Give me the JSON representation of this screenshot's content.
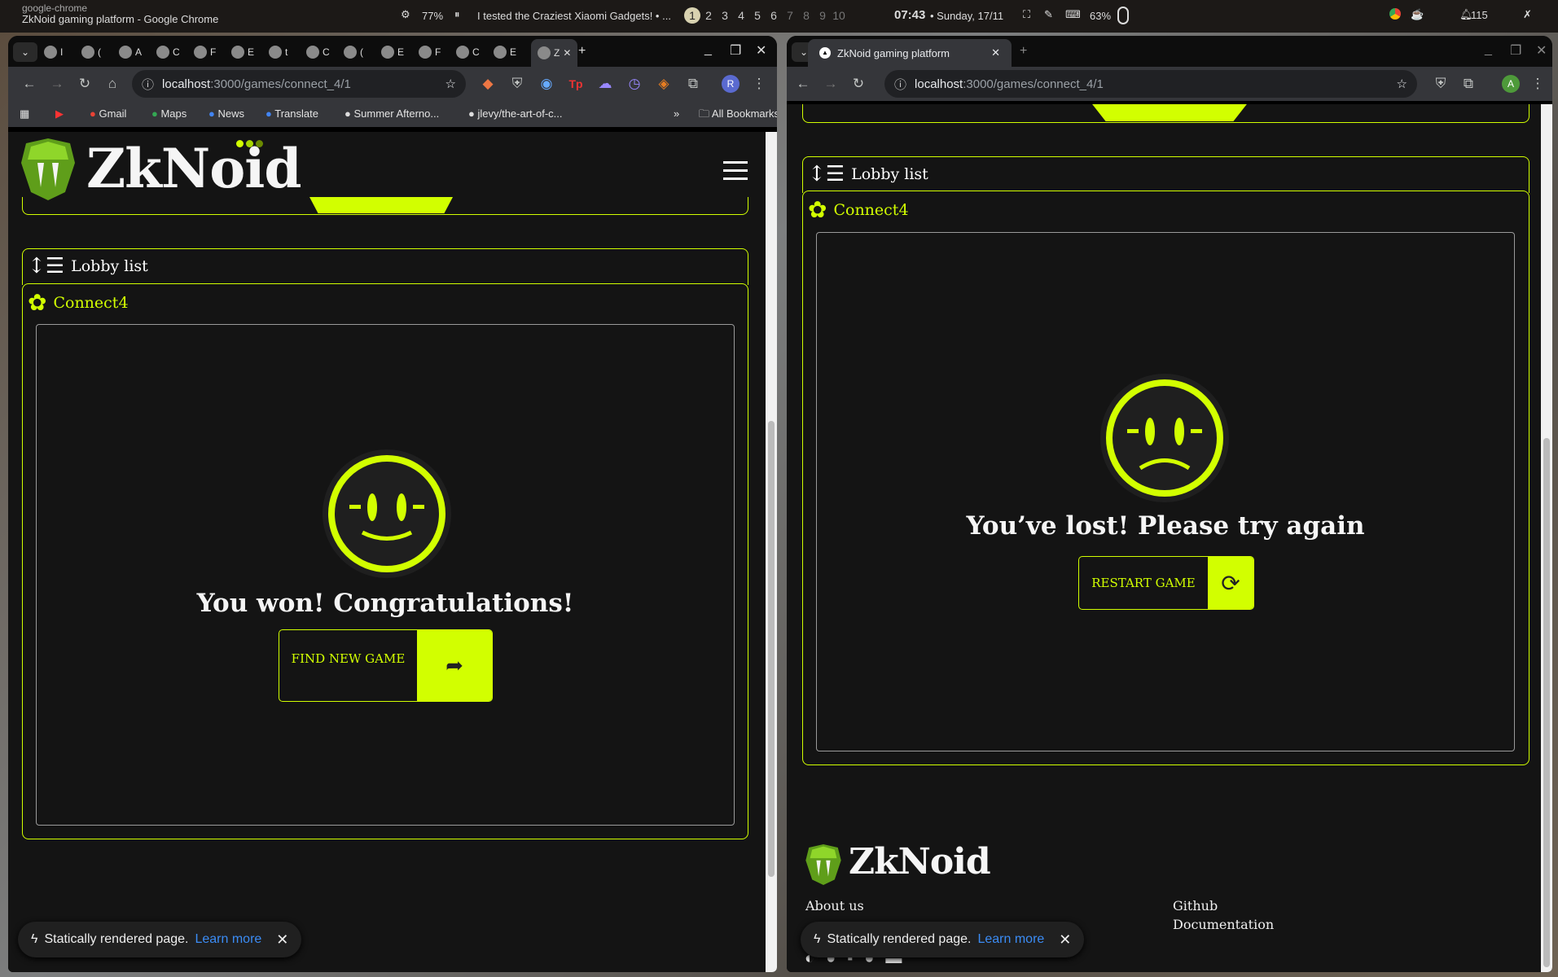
{
  "system_bar": {
    "app_id": "google-chrome",
    "window_title": "ZkNoid gaming platform - Google Chrome",
    "cpu": "77%",
    "media": "I tested the Craziest Xiaomi Gadgets! • ...",
    "workspaces": [
      "1",
      "2",
      "3",
      "4",
      "5",
      "6",
      "7",
      "8",
      "9",
      "10"
    ],
    "active_workspace": "1",
    "time": "07:43",
    "date": "• Sunday, 17/11",
    "battery": "63%",
    "notifications": "115"
  },
  "left_window": {
    "tabs": [
      "I",
      "(",
      "A",
      "C",
      "F",
      "E",
      "t",
      "C",
      "(",
      "E",
      "F",
      "C",
      "E",
      "Z"
    ],
    "url_host": "localhost",
    "url_path": ":3000/games/connect_4/1",
    "profile": "R",
    "bookmarks": [
      "Gmail",
      "Maps",
      "News",
      "Translate",
      "Summer Afterno...",
      "jlevy/the-art-of-c..."
    ],
    "all_bookmarks": "All Bookmarks",
    "logo": "ZkNoid",
    "lobby_list": "Lobby list",
    "game_title": "Connect4",
    "result_message": "You won! Congratulations!",
    "action_button": "FIND NEW GAME",
    "toast_text": "Statically rendered page.",
    "toast_link": "Learn more"
  },
  "right_window": {
    "tab_title": "ZkNoid gaming platform",
    "url_host": "localhost",
    "url_path": ":3000/games/connect_4/1",
    "profile": "A",
    "lobby_list": "Lobby list",
    "game_title": "Connect4",
    "result_message": "You’ve lost! Please try again",
    "action_button": "RESTART GAME",
    "footer_logo": "ZkNoid",
    "footer_links_left": [
      "About us"
    ],
    "footer_links_right": [
      "Github",
      "Documentation"
    ],
    "toast_text": "Statically rendered page.",
    "toast_link": "Learn more"
  },
  "colors": {
    "accent": "#d2ff00",
    "background": "#141414"
  }
}
